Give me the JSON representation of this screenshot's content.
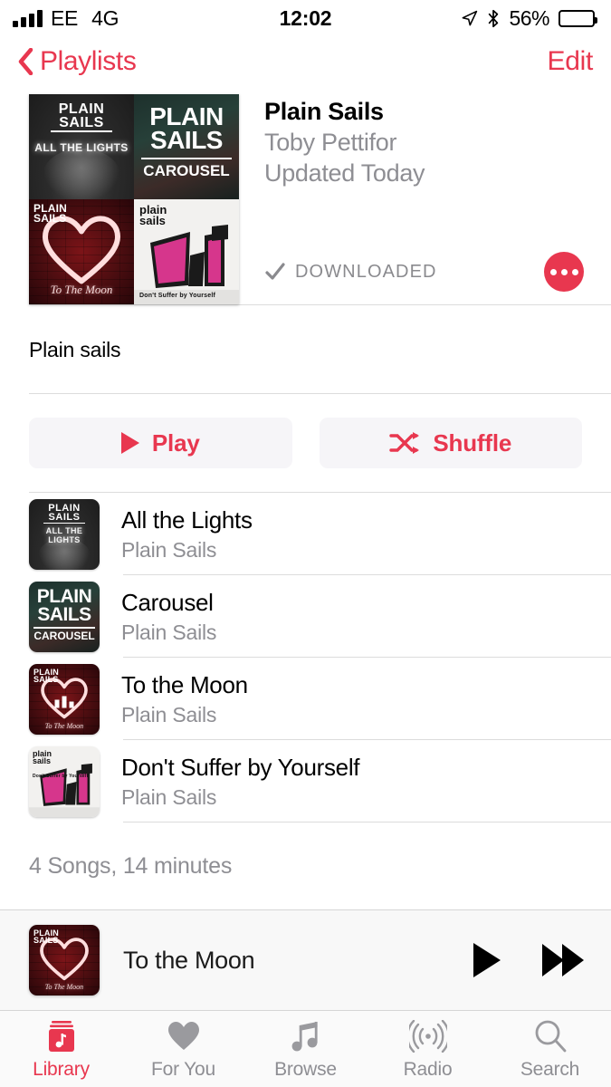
{
  "status_bar": {
    "carrier": "EE",
    "network": "4G",
    "time": "12:02",
    "battery_percent": "56%",
    "battery_level": 56,
    "signal_bars": 4,
    "icons": [
      "signal-bars-icon",
      "location-arrow-icon",
      "bluetooth-icon",
      "battery-icon"
    ]
  },
  "nav_bar": {
    "back_label": "Playlists",
    "edit_label": "Edit"
  },
  "playlist": {
    "title": "Plain Sails",
    "artist": "Toby Pettifor",
    "updated": "Updated Today",
    "downloaded_label": "DOWNLOADED",
    "description": "Plain sails",
    "summary": "4 Songs, 14 minutes",
    "artwork_tiles": [
      {
        "album": "All the Lights",
        "brand": "PLAIN SAILS",
        "subtitle": "ALL THE LIGHTS"
      },
      {
        "album": "Carousel",
        "brand": "PLAIN SAILS",
        "subtitle": "CAROUSEL"
      },
      {
        "album": "To the Moon",
        "brand": "PLAIN SAILS",
        "subtitle": "To The Moon"
      },
      {
        "album": "Don't Suffer by Yourself",
        "brand": "plain sails",
        "subtitle": "Don't Suffer by Yourself"
      }
    ]
  },
  "actions": {
    "play_label": "Play",
    "shuffle_label": "Shuffle"
  },
  "tracks": [
    {
      "title": "All the Lights",
      "artist": "Plain Sails",
      "now_playing": false
    },
    {
      "title": "Carousel",
      "artist": "Plain Sails",
      "now_playing": false
    },
    {
      "title": "To the Moon",
      "artist": "Plain Sails",
      "now_playing": true
    },
    {
      "title": "Don't Suffer by Yourself",
      "artist": "Plain Sails",
      "now_playing": false
    }
  ],
  "mini_player": {
    "title": "To the Moon",
    "play_icon": "play-icon",
    "forward_icon": "fast-forward-icon"
  },
  "tab_bar": {
    "items": [
      {
        "label": "Library",
        "icon": "library-icon",
        "active": true
      },
      {
        "label": "For You",
        "icon": "heart-icon",
        "active": false
      },
      {
        "label": "Browse",
        "icon": "music-note-icon",
        "active": false
      },
      {
        "label": "Radio",
        "icon": "radio-waves-icon",
        "active": false
      },
      {
        "label": "Search",
        "icon": "search-icon",
        "active": false
      }
    ]
  },
  "colors": {
    "accent": "#E8374F",
    "secondary_text": "#8E8E93",
    "button_bg": "#F6F5F8",
    "separator": "#DCDCDC"
  }
}
